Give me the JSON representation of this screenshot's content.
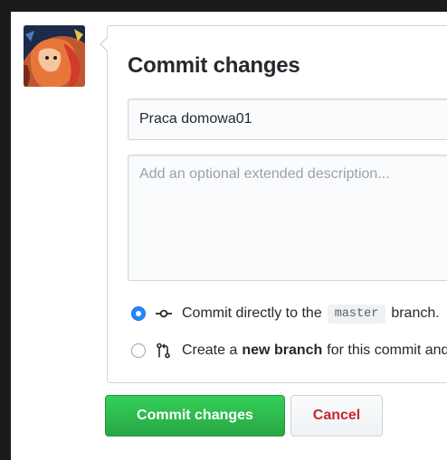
{
  "avatar": {
    "icon": "user-avatar-icon"
  },
  "form": {
    "title": "Commit changes",
    "summary_value": "Praca domowa01",
    "description_placeholder": "Add an optional extended description..."
  },
  "options": {
    "direct": {
      "checked": true,
      "icon": "git-commit-icon",
      "text": "Commit directly to the",
      "branch": "master",
      "trailing": "branch."
    },
    "new_branch": {
      "checked": false,
      "icon": "git-pull-request-icon",
      "text_before": "Create a",
      "text_bold": "new branch",
      "text_after": "for this commit and start a pull request."
    }
  },
  "buttons": {
    "commit_label": "Commit changes",
    "cancel_label": "Cancel"
  },
  "colors": {
    "primary_button": "#2ea44f",
    "cancel_text": "#cb2431",
    "radio_checked": "#2188ff"
  }
}
